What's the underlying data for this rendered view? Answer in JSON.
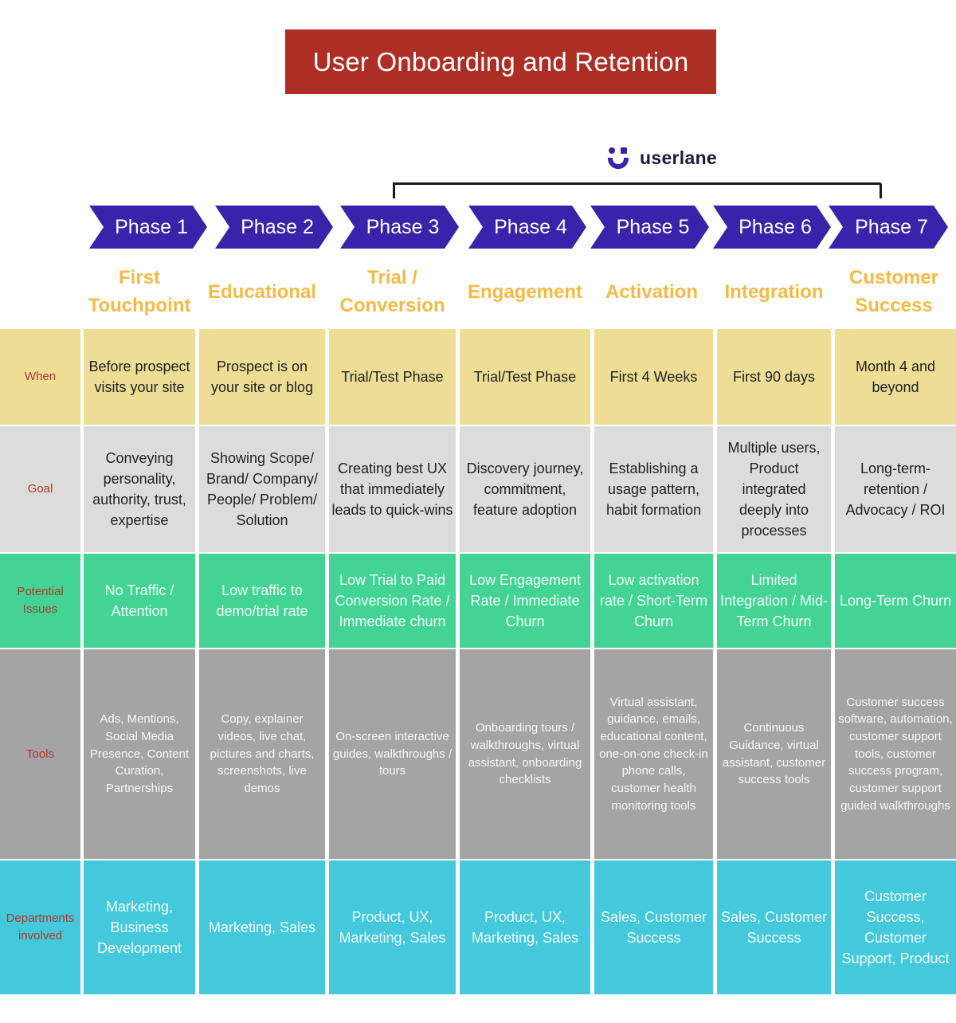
{
  "title": "User Onboarding and Retention",
  "brand": {
    "name": "userlane",
    "icon": "userlane-logo-icon",
    "color": "#3a23ab"
  },
  "colors": {
    "title_bg": "#ad2e24",
    "phase_bg": "#3a23ab",
    "stage_text": "#f5b944",
    "row_label_text": "#b0392b",
    "when_bg": "#eddd95",
    "goal_bg": "#dcdcdc",
    "issues_bg": "#43d395",
    "tools_bg": "#a4a4a4",
    "departments_bg": "#43c8dc"
  },
  "bracket_span": {
    "from_phase": "Phase 3",
    "to_phase": "Phase 7"
  },
  "phases": [
    {
      "label": "Phase 1",
      "stage": "First Touchpoint"
    },
    {
      "label": "Phase 2",
      "stage": "Educational"
    },
    {
      "label": "Phase 3",
      "stage": "Trial / Conversion"
    },
    {
      "label": "Phase 4",
      "stage": "Engagement"
    },
    {
      "label": "Phase 5",
      "stage": "Activation"
    },
    {
      "label": "Phase 6",
      "stage": "Integration"
    },
    {
      "label": "Phase 7",
      "stage": "Customer Success"
    }
  ],
  "rows": [
    {
      "label": "When",
      "cells": [
        "Before prospect visits your site",
        "Prospect is on your site or blog",
        "Trial/Test Phase",
        "Trial/Test Phase",
        "First 4 Weeks",
        "First 90 days",
        "Month 4 and beyond"
      ]
    },
    {
      "label": "Goal",
      "cells": [
        "Conveying personality, authority, trust, expertise",
        "Showing Scope/ Brand/ Company/ People/ Problem/ Solution",
        "Creating best UX that immediately leads to quick-wins",
        "Discovery journey, commitment, feature adoption",
        "Establishing a usage pattern, habit formation",
        "Multiple users, Product integrated deeply into processes",
        "Long-term-retention / Advocacy / ROI"
      ]
    },
    {
      "label": "Potential Issues",
      "cells": [
        "No Traffic / Attention",
        "Low traffic to demo/trial  rate",
        "Low Trial to Paid Conversion Rate / Immediate churn",
        "Low Engagement Rate / Immediate Churn",
        "Low activation rate / Short-Term Churn",
        "Limited Integration / Mid-Term Churn",
        "Long-Term Churn"
      ]
    },
    {
      "label": "Tools",
      "cells": [
        "Ads, Mentions, Social Media Presence, Content Curation, Partnerships",
        "Copy, explainer videos, live chat, pictures and charts, screenshots, live demos",
        "On-screen interactive guides, walkthroughs / tours",
        "Onboarding tours / walkthroughs, virtual assistant, onboarding checklists",
        "Virtual assistant, guidance, emails, educational content,  one-on-one check-in phone calls, customer health monitoring tools",
        "Continuous Guidance, virtual assistant, customer success tools",
        "Customer success software, automation, customer support tools, customer success program, customer support guided walkthroughs"
      ]
    },
    {
      "label": "Departments involved",
      "cells": [
        "Marketing, Business Development",
        "Marketing, Sales",
        "Product, UX, Marketing, Sales",
        "Product, UX, Marketing, Sales",
        "Sales, Customer Success",
        "Sales, Customer Success",
        "Customer Success, Customer Support, Product"
      ]
    }
  ]
}
